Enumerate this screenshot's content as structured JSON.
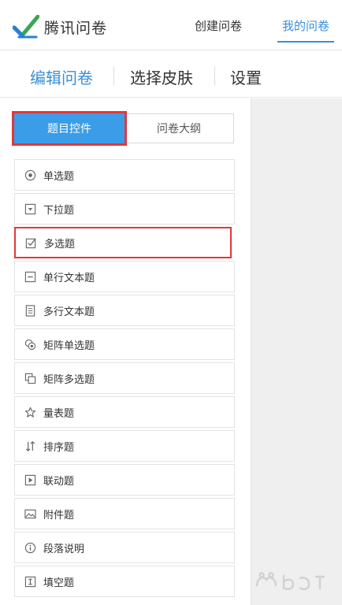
{
  "header": {
    "logo_text": "腾讯问卷",
    "nav": {
      "create": "创建问卷",
      "mine": "我的问卷"
    }
  },
  "subnav": {
    "edit": "编辑问卷",
    "skin": "选择皮肤",
    "settings": "设置"
  },
  "panel": {
    "tab_controls": "题目控件",
    "tab_outline": "问卷大纲"
  },
  "question_types": [
    {
      "label": "单选题",
      "icon": "radio-icon"
    },
    {
      "label": "下拉题",
      "icon": "dropdown-icon"
    },
    {
      "label": "多选题",
      "icon": "checkbox-icon"
    },
    {
      "label": "单行文本题",
      "icon": "single-line-text-icon"
    },
    {
      "label": "多行文本题",
      "icon": "multi-line-text-icon"
    },
    {
      "label": "矩阵单选题",
      "icon": "matrix-radio-icon"
    },
    {
      "label": "矩阵多选题",
      "icon": "matrix-checkbox-icon"
    },
    {
      "label": "量表题",
      "icon": "star-icon"
    },
    {
      "label": "排序题",
      "icon": "sort-icon"
    },
    {
      "label": "联动题",
      "icon": "linked-icon"
    },
    {
      "label": "附件题",
      "icon": "attachment-image-icon"
    },
    {
      "label": "段落说明",
      "icon": "info-icon"
    },
    {
      "label": "填空题",
      "icon": "fill-blank-icon"
    }
  ],
  "colors": {
    "accent": "#3a8fd9",
    "active_tab_bg": "#3b9ce8",
    "highlight": "#e0383b"
  }
}
